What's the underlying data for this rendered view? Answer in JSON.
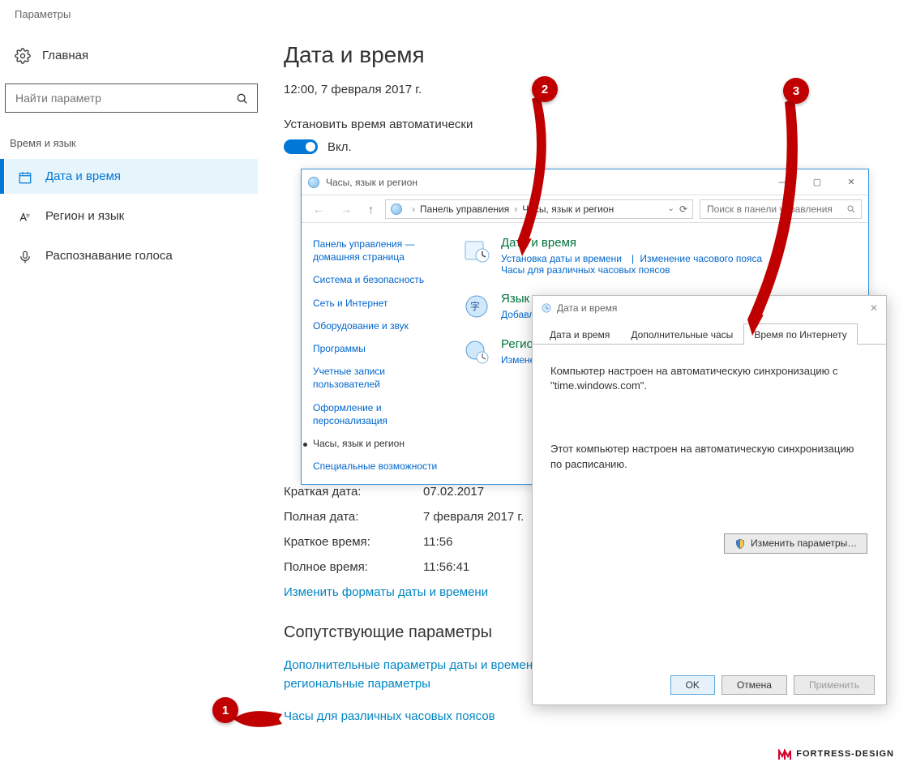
{
  "app": {
    "title": "Параметры"
  },
  "sidebar": {
    "home": "Главная",
    "search_placeholder": "Найти параметр",
    "section_label": "Время и язык",
    "items": [
      {
        "label": "Дата и время"
      },
      {
        "label": "Регион и язык"
      },
      {
        "label": "Распознавание голоса"
      }
    ]
  },
  "main": {
    "heading": "Дата и время",
    "datetime_now": "12:00, 7 февраля 2017 г.",
    "auto_time_label": "Установить время автоматически",
    "toggle_state": "Вкл.",
    "formats": [
      {
        "k": "Краткая дата:",
        "v": "07.02.2017"
      },
      {
        "k": "Полная дата:",
        "v": "7 февраля 2017 г."
      },
      {
        "k": "Краткое время:",
        "v": "11:56"
      },
      {
        "k": "Полное время:",
        "v": "11:56:41"
      }
    ],
    "change_formats_link": "Изменить форматы даты и времени",
    "related_heading": "Сопутствующие параметры",
    "related_links": [
      "Дополнительные параметры даты и времени, региональные параметры",
      "Часы для различных часовых поясов"
    ]
  },
  "cp": {
    "title": "Часы, язык и регион",
    "breadcrumb": [
      "Панель управления",
      "Часы, язык и регион"
    ],
    "search_placeholder": "Поиск в панели управления",
    "side_links": [
      "Панель управления — домашняя страница",
      "Система и безопасность",
      "Сеть и Интернет",
      "Оборудование и звук",
      "Программы",
      "Учетные записи пользователей",
      "Оформление и персонализация",
      "Часы, язык и регион",
      "Специальные возможности"
    ],
    "cats": [
      {
        "title": "Дата и время",
        "subs": [
          "Установка даты и времени",
          "Изменение часового пояса",
          "Часы для различных часовых поясов"
        ]
      },
      {
        "title": "Язык",
        "subs": [
          "Добавление"
        ]
      },
      {
        "title": "Региональ",
        "subs": [
          "Изменение"
        ]
      }
    ]
  },
  "dt": {
    "title": "Дата и время",
    "tabs": [
      "Дата и время",
      "Дополнительные часы",
      "Время по Интернету"
    ],
    "line1": "Компьютер настроен на автоматическую синхронизацию с \"time.windows.com\".",
    "line2": "Этот компьютер настроен на автоматическую синхронизацию по расписанию.",
    "change_btn": "Изменить параметры…",
    "ok": "OK",
    "cancel": "Отмена",
    "apply": "Применить"
  },
  "annotations": {
    "one": "1",
    "two": "2",
    "three": "3"
  },
  "watermark": "FORTRESS-DESIGN"
}
